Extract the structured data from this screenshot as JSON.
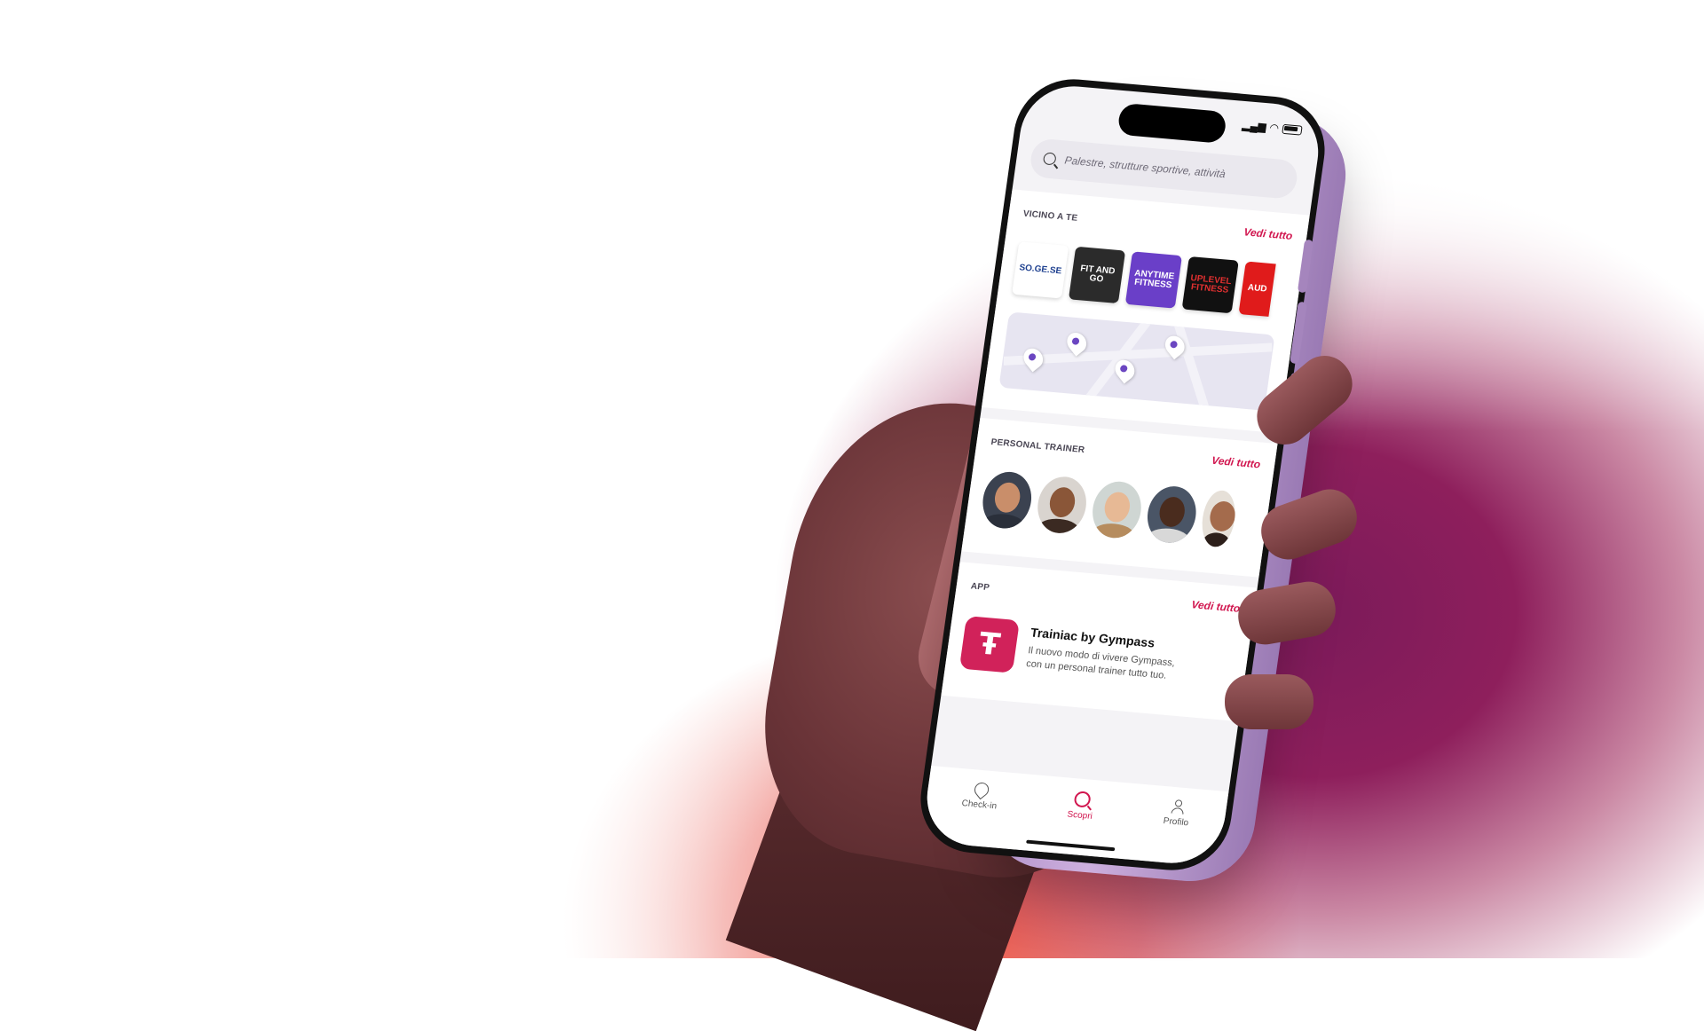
{
  "search": {
    "placeholder": "Palestre, strutture sportive, attività"
  },
  "sections": {
    "nearby": {
      "title": "VICINO A TE",
      "see_all": "Vedi tutto",
      "gyms": [
        {
          "name": "Piscine SO.GE.SE",
          "label": "SO.GE.SE",
          "bg": "#ffffff",
          "fg": "#1d3f8f"
        },
        {
          "name": "Fit and Go",
          "label": "FIT AND GO",
          "bg": "#2b2b2b",
          "fg": "#ffffff"
        },
        {
          "name": "Anytime Fitness",
          "label": "ANYTIME FITNESS",
          "bg": "#6a3fc8",
          "fg": "#ffffff"
        },
        {
          "name": "Up Level Fitness",
          "label": "UPLEVEL FITNESS",
          "bg": "#111111",
          "fg": "#e03030"
        },
        {
          "name": "Audace",
          "label": "AUD",
          "bg": "#e01b1b",
          "fg": "#ffffff"
        }
      ]
    },
    "trainers": {
      "title": "PERSONAL TRAINER",
      "see_all": "Vedi tutto"
    },
    "app": {
      "title": "APP",
      "see_all": "Vedi tutto",
      "name": "Trainiac by Gympass",
      "description": "Il nuovo modo di vivere Gympass, con un personal trainer tutto tuo.",
      "icon_glyph": "Ŧ"
    }
  },
  "tabbar": {
    "tabs": [
      {
        "label": "Check-in",
        "icon": "pin-icon",
        "active": false
      },
      {
        "label": "Scopri",
        "icon": "search-icon",
        "active": true
      },
      {
        "label": "Profilo",
        "icon": "user-icon",
        "active": false
      }
    ]
  },
  "colors": {
    "accent": "#d1164f",
    "app_icon": "#d1225a",
    "glow": "#8e1f5c",
    "glow_warm": "#f0503a"
  }
}
